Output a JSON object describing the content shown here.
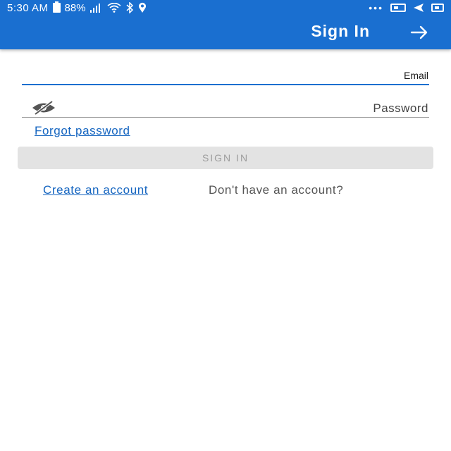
{
  "status_bar": {
    "time": "5:30 AM",
    "battery": "88%",
    "icons": [
      "battery-icon",
      "signal-icon",
      "wifi-icon",
      "bluetooth-icon",
      "location-icon",
      "more-dots-icon",
      "screenshot-icon",
      "send-icon",
      "image-icon"
    ]
  },
  "app_bar": {
    "title": "Sign In",
    "nav_icon": "arrow-icon",
    "background": "#1a6fd0"
  },
  "form": {
    "email_label": "Email",
    "password_label": "Password",
    "password_visibility_icon": "eye-off-icon",
    "forgot_password": "Forgot password",
    "sign_in_button": "SIGN IN",
    "no_account_text": "Don't have an account?",
    "create_account": "Create an account"
  },
  "colors": {
    "primary": "#1a6fd0",
    "link": "#1565c0",
    "button_disabled_bg": "#e3e3e3",
    "button_disabled_text": "#9d9d9d"
  }
}
